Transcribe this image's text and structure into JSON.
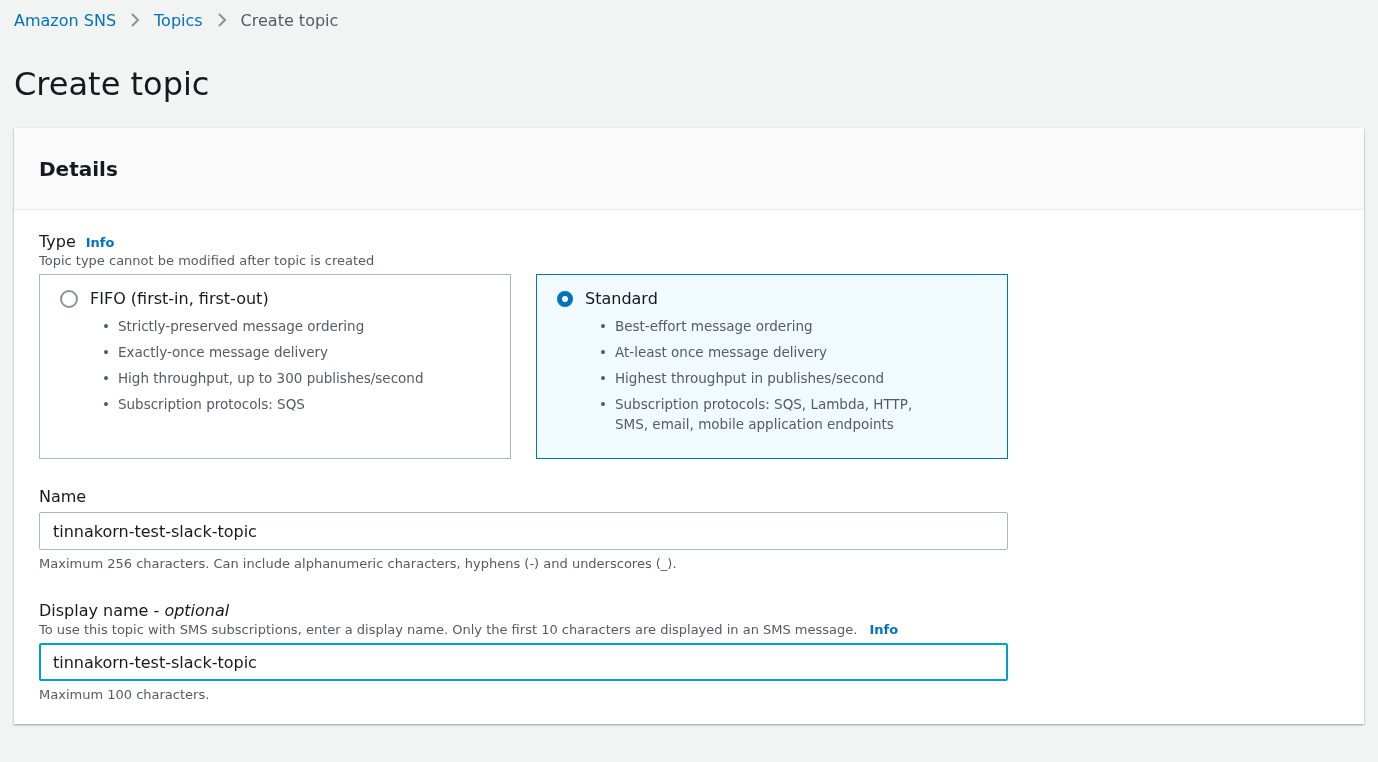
{
  "breadcrumbs": [
    {
      "label": "Amazon SNS",
      "kind": "link"
    },
    {
      "label": "Topics",
      "kind": "link"
    },
    {
      "label": "Create topic",
      "kind": "current"
    }
  ],
  "title": "Create topic",
  "panel": {
    "title": "Details",
    "type_field": {
      "label": "Type",
      "info": "Info",
      "description": "Topic type cannot be modified after topic is created",
      "bullet": "•",
      "options": [
        {
          "label": "FIFO (first-in, first-out)",
          "selected": false,
          "features": [
            "Strictly-preserved message ordering",
            "Exactly-once message delivery",
            "High throughput, up to 300 publishes/second",
            "Subscription protocols: SQS"
          ]
        },
        {
          "label": "Standard",
          "selected": true,
          "features": [
            "Best-effort message ordering",
            "At-least once message delivery",
            "Highest throughput in publishes/second",
            "Subscription protocols: SQS, Lambda, HTTP, SMS, email, mobile application endpoints"
          ]
        }
      ]
    },
    "fields": [
      {
        "label": "Name",
        "value": "tinnakorn-test-slack-topic",
        "focused": false,
        "hint": "Maximum 256 characters. Can include alphanumeric characters, hyphens (-) and underscores (_)."
      },
      {
        "label": "Display name - *optional*",
        "description": "To use this topic with SMS subscriptions, enter a display name. Only the first 10 characters are displayed in an SMS message.",
        "info": "Info",
        "value": "tinnakorn-test-slack-topic",
        "focused": true,
        "hint": "Maximum 100 characters."
      }
    ]
  }
}
